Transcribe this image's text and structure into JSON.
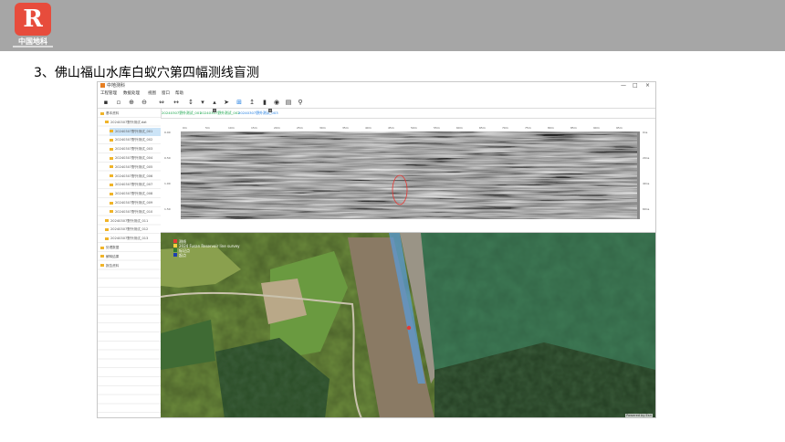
{
  "header": {
    "logo_glyph": "R",
    "logo_name": "中国地科",
    "slide_title": "3、佛山福山水库白蚁穴第四幅测线盲测"
  },
  "app": {
    "window_title": "中地测科",
    "window_controls": [
      "—",
      "□",
      "×"
    ],
    "menu": [
      "工程管理",
      "数据处理",
      "视图",
      "窗口",
      "帮助"
    ],
    "toolbar_icons": [
      "new-file-icon",
      "open-folder-icon",
      "zoom-in-icon",
      "zoom-out-icon",
      "fit-width-icon",
      "horizontal-expand-icon",
      "vertical-expand-icon",
      "arrow-down-icon",
      "marker-icon",
      "pointer-icon",
      "crosshair-icon",
      "move-up-icon",
      "delete-icon",
      "eye-icon",
      "layers-icon",
      "share-icon"
    ],
    "tree": [
      {
        "label": "基本资料",
        "level": 0,
        "selected": false
      },
      {
        "label": "20240307野外测试.dat",
        "level": 1,
        "selected": false
      },
      {
        "label": "20240307野外测试_001",
        "level": 2,
        "selected": true
      },
      {
        "label": "20240307野外测试_002",
        "level": 2,
        "selected": false
      },
      {
        "label": "20240307野外测试_003",
        "level": 2,
        "selected": false
      },
      {
        "label": "20240307野外测试_004",
        "level": 2,
        "selected": false
      },
      {
        "label": "20240307野外测试_005",
        "level": 2,
        "selected": false
      },
      {
        "label": "20240307野外测试_006",
        "level": 2,
        "selected": false
      },
      {
        "label": "20240307野外测试_007",
        "level": 2,
        "selected": false
      },
      {
        "label": "20240307野外测试_008",
        "level": 2,
        "selected": false
      },
      {
        "label": "20240307野外测试_009",
        "level": 2,
        "selected": false
      },
      {
        "label": "20240307野外测试_010",
        "level": 2,
        "selected": false
      },
      {
        "label": "20240307野外测试_011",
        "level": 1,
        "selected": false
      },
      {
        "label": "20240307野外测试_012",
        "level": 1,
        "selected": false
      },
      {
        "label": "20240307野外测试_013",
        "level": 1,
        "selected": false
      },
      {
        "label": "处理数据",
        "level": 0,
        "selected": false
      },
      {
        "label": "解释结果",
        "level": 0,
        "selected": false
      },
      {
        "label": "报告资料",
        "level": 0,
        "selected": false
      }
    ],
    "tabs": [
      {
        "label": "20240307野外测试_001",
        "active": false
      },
      {
        "label": "20240307野外测试_002",
        "active": false
      },
      {
        "label": "20240307野外测试_003",
        "active": true
      }
    ],
    "gpr": {
      "top_ticks": [
        "0m",
        "5m",
        "10m",
        "15m",
        "20m",
        "25m",
        "30m",
        "35m",
        "40m",
        "45m",
        "50m",
        "55m",
        "60m",
        "65m",
        "70m",
        "75m",
        "80m",
        "85m",
        "90m",
        "95m"
      ],
      "left_ticks": [
        "0.00",
        "0.50",
        "1.00",
        "1.50"
      ],
      "right_ticks": [
        "0ns",
        "20ns",
        "40ns",
        "60ns"
      ],
      "anomaly_color": "#e53935"
    },
    "map": {
      "legend": [
        {
          "label": "测线",
          "color": "#e53935"
        },
        {
          "label": "2024 Fusan Reservoir line survey",
          "color": "#f4d03f"
        },
        {
          "label": "标记点",
          "color": "#2e7d32"
        },
        {
          "label": "起点",
          "color": "#1e40af"
        }
      ],
      "attribution": "Powered by Esri",
      "line_color": "#5b9bd5"
    }
  },
  "colors": {
    "topbar": "#a6a6a6",
    "logo": "#e74c3c",
    "water": "#3e7a55",
    "farmland": "#6f8f3e",
    "forest": "#2f4a2a",
    "dam": "#8a7a64"
  }
}
